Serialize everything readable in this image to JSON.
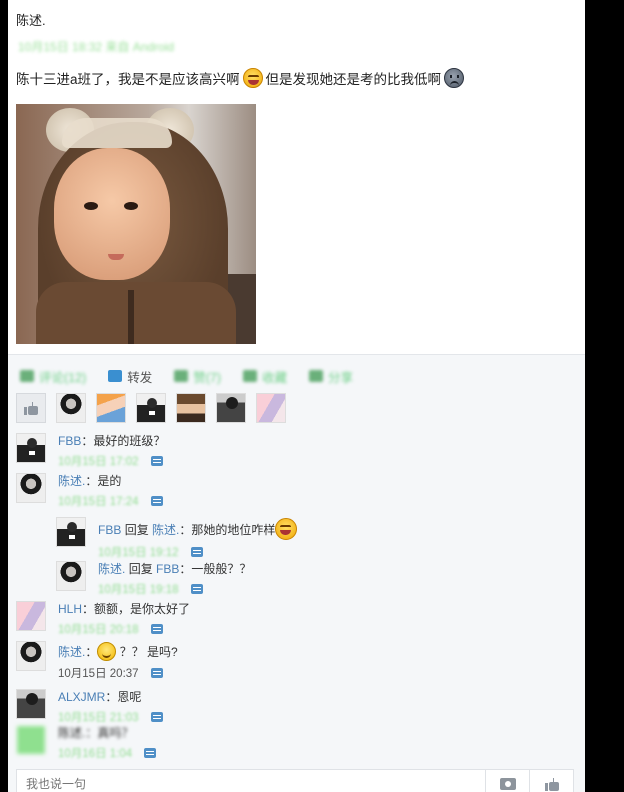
{
  "post": {
    "author": "陈述.",
    "blurred_meta": "10月15日 18:32 来自 Android",
    "text_part1": "陈十三进a班了，我是不是应该高兴啊",
    "text_part2": "但是发现她还是考的比我低啊",
    "emoji1": "laugh-emoji-icon",
    "emoji2": "sad-emoji-icon"
  },
  "actions": {
    "comment": "评论(12)",
    "share": "转发",
    "like": "赞(7)",
    "collect": "收藏",
    "share2": "分享"
  },
  "comments": [
    {
      "user": "FBB",
      "text": "：最好的班级？",
      "time": "10月15日 17:02"
    },
    {
      "user": "陈述.",
      "text": "：是的",
      "time": "10月15日 17:24"
    },
    {
      "user": "FBB",
      "reply_word": "回复",
      "target": "陈述.",
      "text": "：那她的地位咋样",
      "time": "10月15日 19:12"
    },
    {
      "user": "陈述.",
      "reply_word": "回复",
      "target": "FBB",
      "text": "：一般般？？",
      "time": "10月15日 19:18"
    },
    {
      "user": "HLH",
      "text": "：额额，是你太好了",
      "time": "10月15日 20:18"
    },
    {
      "user": "陈述.",
      "text": "？？ 是吗?",
      "time": "10月15日 20:37"
    },
    {
      "user": "ALXJMR",
      "text": "：恩呢",
      "time": "10月15日 21:03"
    },
    {
      "user": "陈述.",
      "text": "：真吗？",
      "time": "10月16日 1:04"
    }
  ],
  "input": {
    "placeholder": "我也说一句"
  }
}
